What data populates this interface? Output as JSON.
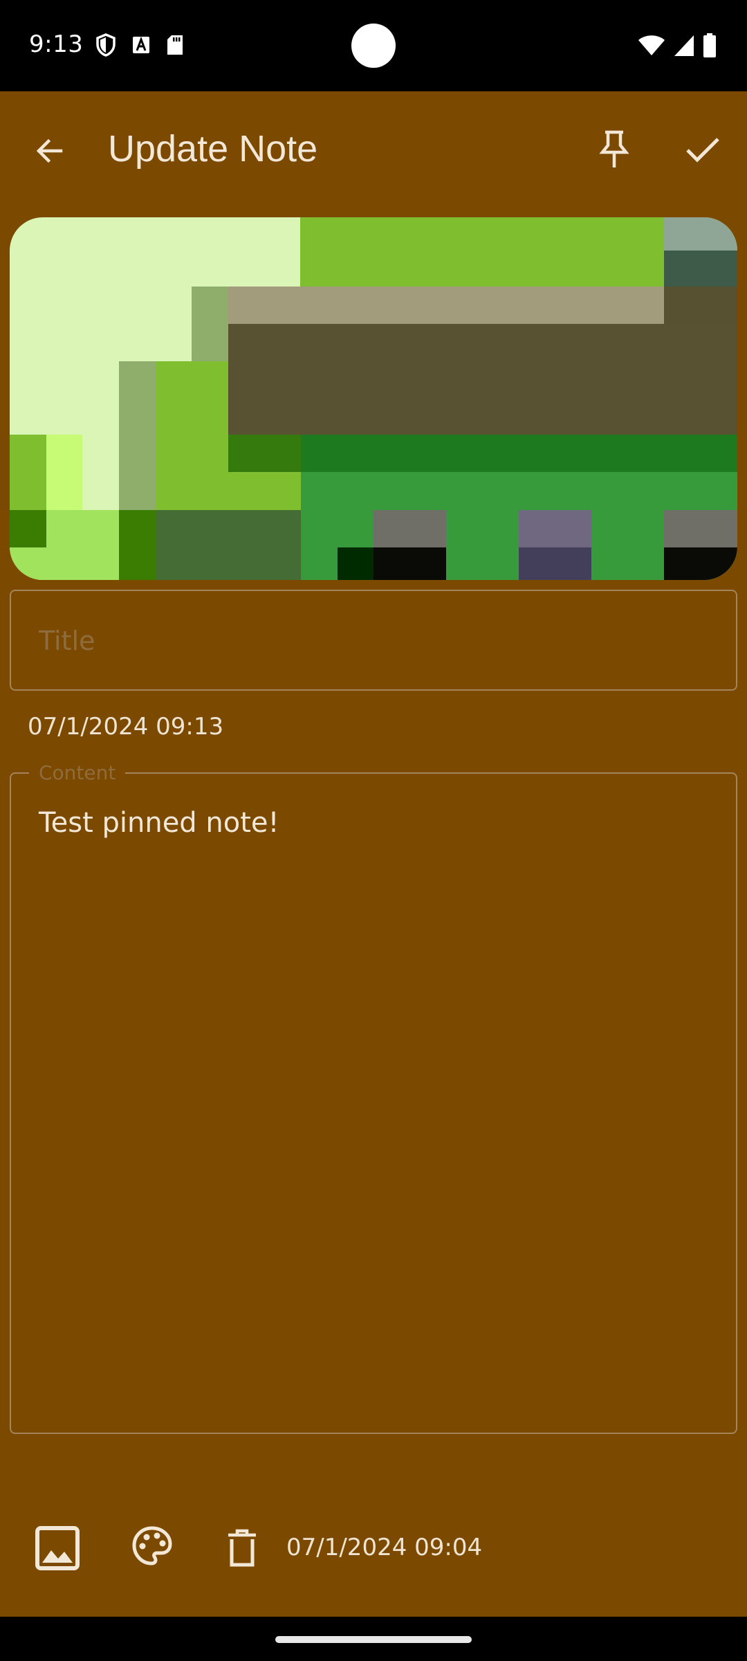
{
  "status_bar": {
    "time": "9:13",
    "left_icons": [
      "shield-icon",
      "font-a-icon",
      "sd-card-icon"
    ],
    "right_icons": [
      "wifi-icon",
      "signal-icon",
      "battery-icon"
    ]
  },
  "toolbar": {
    "title": "Update Note",
    "back_icon": "arrow-back-icon",
    "pin_icon": "push-pin-icon",
    "save_icon": "check-icon"
  },
  "note": {
    "title_placeholder": "Title",
    "title_value": "",
    "created": "07/1/2024 09:13",
    "content_label": "Content",
    "content_value": "Test pinned note!"
  },
  "bottom_bar": {
    "image_icon": "image-icon",
    "palette_icon": "palette-icon",
    "delete_icon": "delete-icon",
    "edited": "07/1/2024 09:04"
  },
  "colors": {
    "note_background": "#7b4a00",
    "system_bars": "#000000",
    "text": "#f3e8d8",
    "outline": "#a4845a"
  }
}
